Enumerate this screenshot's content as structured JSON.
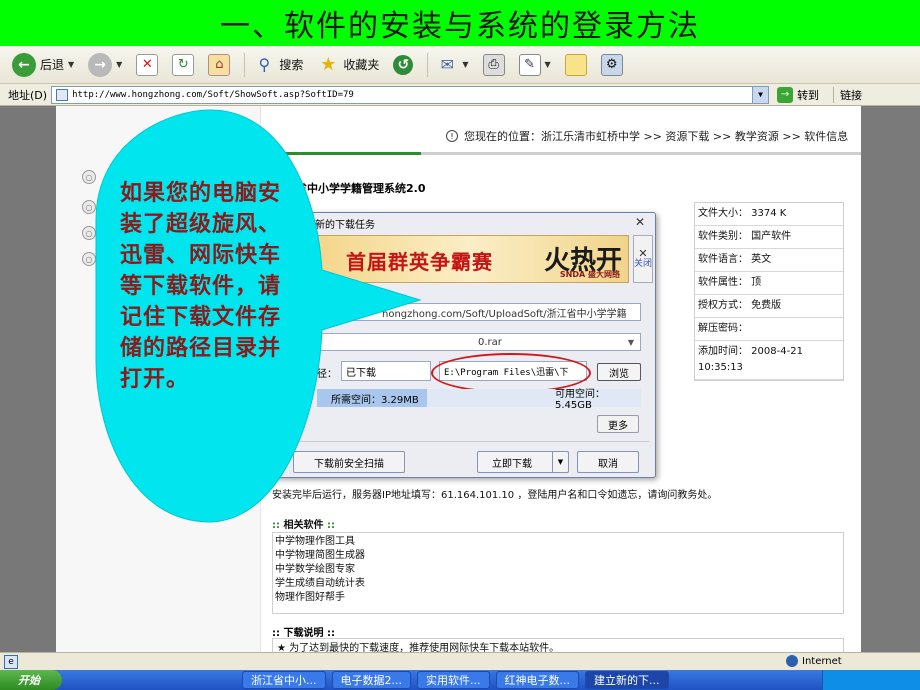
{
  "slide": {
    "title": "一、软件的安装与系统的登录方法"
  },
  "toolbar": {
    "back_label": "后退",
    "search_label": "搜索",
    "favorites_label": "收藏夹"
  },
  "addressbar": {
    "label": "地址(D)",
    "url": "http://www.hongzhong.com/Soft/ShowSoft.asp?SoftID=79",
    "go_label": "转到",
    "links_label": "链接"
  },
  "page": {
    "breadcrumb": "您现在的位置：浙江乐清市虹桥中学 >> 资源下载 >> 教学资源 >> 软件信息",
    "software_title": "省中小学学籍管理系统2.0",
    "info": [
      "文件大小：  3374 K",
      "软件类别：  国产软件",
      "软件语言：  英文",
      "软件属性：  顶",
      "授权方式：  免费版",
      "解压密码：",
      "添加时间：  2008-4-21 10:35:13"
    ],
    "install_note": "安装完毕后运行，服务器IP地址填写：61.164.101.10    ，登陆用户名和口令如遗忘，请询问教务处。",
    "related_title_prefix": ":: ",
    "related_title": "相关软件",
    "related_title_suffix": " ::",
    "related_items": [
      "中学物理作图工具",
      "中学物理简图生成器",
      "中学数学绘图专家",
      "学生成绩自动统计表",
      "物理作图好帮手"
    ],
    "download_desc_title": ":: 下载说明 ::",
    "download_desc_text": "★ 为了达到最快的下载速度，推荐使用网际快车下载本站软件。"
  },
  "dialog": {
    "title": "新的下载任务",
    "banner_text": "首届群英争霸赛",
    "banner_hot": "火热开战",
    "banner_brand": "SNDA 盛大网络",
    "banner_close": "关闭",
    "url": "hongzhong.com/Soft/UploadSoft/浙江省中小学学籍",
    "filename": "0.rar",
    "path_label": "径：",
    "category": "已下载",
    "save_path": "E:\\Program Files\\迅雷\\下",
    "browse_label": "浏览",
    "space_needed": "所需空间：3.29MB",
    "space_available": "可用空间：5.45GB",
    "more_label": "更多",
    "scan_label": "下载前安全扫描",
    "download_now_label": "立即下载",
    "cancel_label": "取消"
  },
  "bubble": {
    "text": "如果您的电脑安装了超级旋风、迅雷、网际快车等下载软件，请记住下载文件存储的路径目录并打开。"
  },
  "statusbar": {
    "zone": "Internet"
  },
  "taskbar": {
    "start_label": "开始",
    "tasks": [
      "浙江省中小...",
      "电子数据2...",
      "实用软件...",
      "红神电子数...",
      "建立新的下..."
    ]
  }
}
